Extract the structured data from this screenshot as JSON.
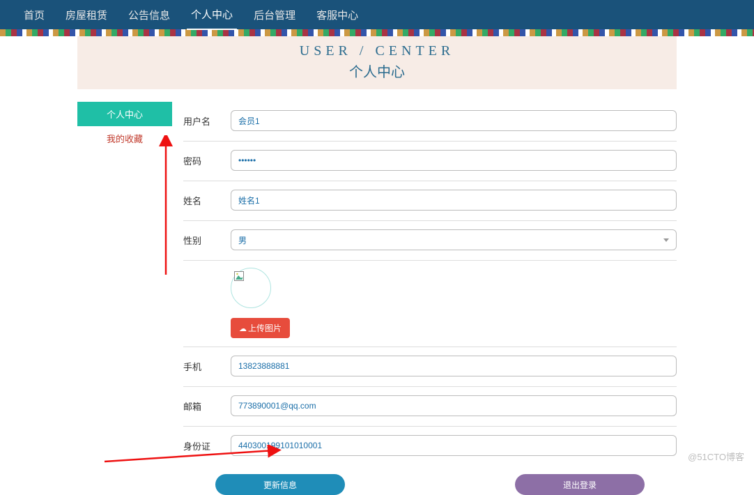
{
  "nav": {
    "items": [
      {
        "label": "首页"
      },
      {
        "label": "房屋租赁"
      },
      {
        "label": "公告信息"
      },
      {
        "label": "个人中心",
        "active": true
      },
      {
        "label": "后台管理"
      },
      {
        "label": "客服中心"
      }
    ]
  },
  "page_title": {
    "en": "USER / CENTER",
    "cn": "个人中心"
  },
  "sidebar": {
    "items": [
      {
        "label": "个人中心",
        "active": true
      },
      {
        "label": "我的收藏"
      }
    ]
  },
  "form": {
    "username": {
      "label": "用户名",
      "value": "会员1"
    },
    "password": {
      "label": "密码",
      "value": "••••••"
    },
    "name": {
      "label": "姓名",
      "value": "姓名1"
    },
    "gender": {
      "label": "性别",
      "selected": "男"
    },
    "upload": {
      "label": "上传图片"
    },
    "phone": {
      "label": "手机",
      "value": "13823888881"
    },
    "email": {
      "label": "邮箱",
      "value": "773890001@qq.com"
    },
    "idcard": {
      "label": "身份证",
      "value": "440300199101010001"
    }
  },
  "actions": {
    "update": "更新信息",
    "logout": "退出登录"
  },
  "watermark": "@51CTO博客"
}
